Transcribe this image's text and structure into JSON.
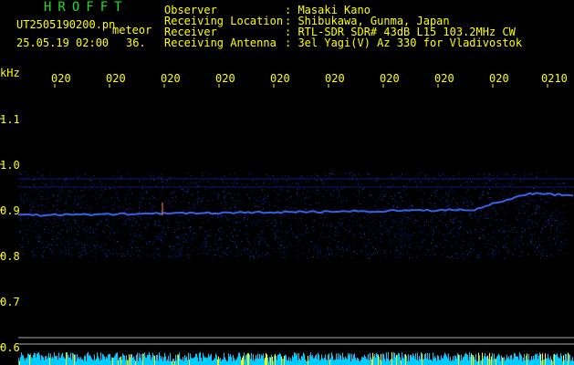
{
  "header": {
    "brand": "HROFFT",
    "filename": "UT2505190200.pn",
    "meteor_label": "meteor",
    "datetime": "25.05.19 02:00",
    "count": "36.",
    "observer_label": "Observer",
    "observer_value": ": Masaki Kano",
    "location_label": "Receiving Location",
    "location_value": ": Shibukawa, Gunma, Japan",
    "receiver_label": "Receiver",
    "receiver_value": ": RTL-SDR SDR# 43dB L15 103.2MHz CW",
    "antenna_label": "Receiving Antenna",
    "antenna_value": ": 3el Yagi(V) Az 330 for Vladivostok"
  },
  "axis": {
    "unit": "kHz",
    "y_ticks": [
      "1.1",
      "1.0",
      "0.9",
      "0.8",
      "0.7",
      "0.6"
    ],
    "x_ticks": [
      "020",
      "020",
      "020",
      "020",
      "020",
      "020",
      "020",
      "020",
      "020",
      "0210"
    ]
  },
  "colors": {
    "text": "#ffff00",
    "brand": "#22dd22",
    "trace": "#3a6cff",
    "noise": "#1020a0",
    "bottom_noise": "#00ccff"
  }
}
